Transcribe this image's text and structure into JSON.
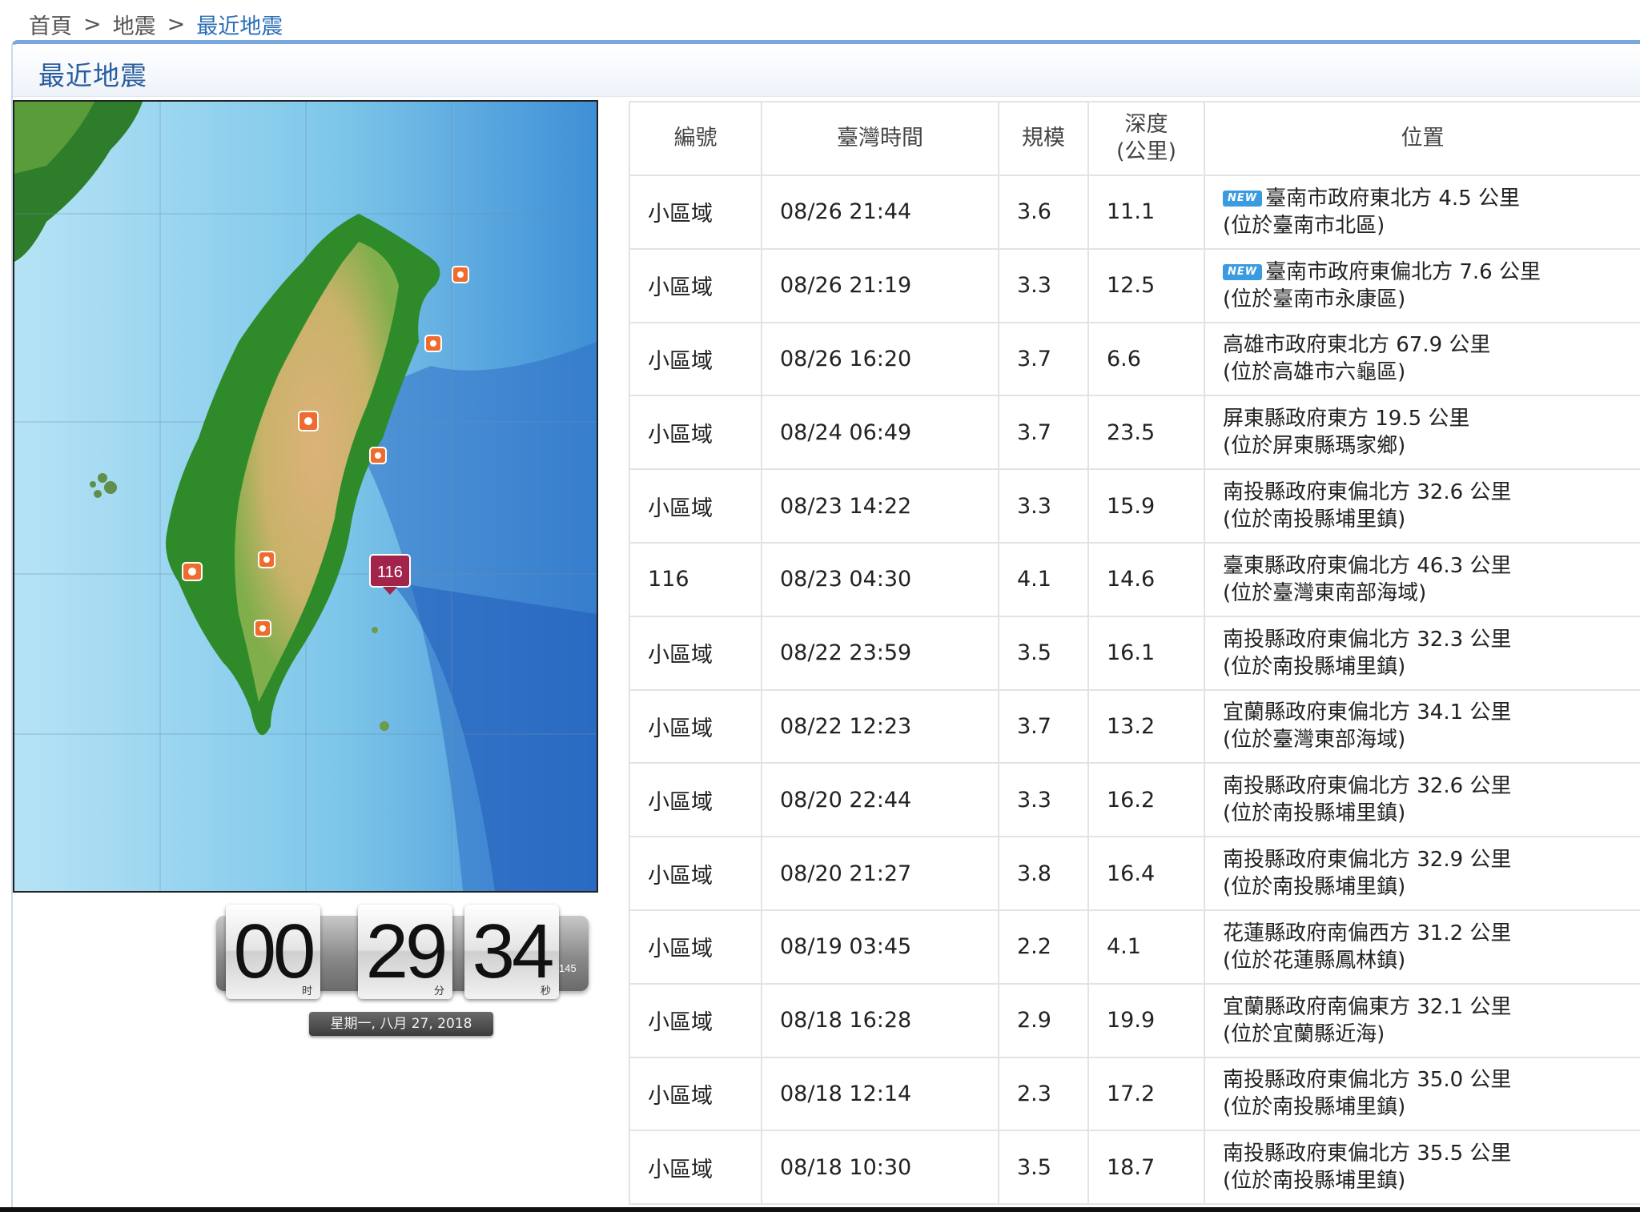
{
  "breadcrumb": {
    "home": "首頁",
    "separator": ">",
    "section": "地震",
    "current": "最近地震"
  },
  "panel": {
    "title": "最近地震"
  },
  "map": {
    "marker_label": "116"
  },
  "clock": {
    "hours": "00",
    "minutes": "29",
    "seconds": "34",
    "hours_unit": "时",
    "minutes_unit": "分",
    "seconds_unit": "秒",
    "milliseconds": "145",
    "date": "星期一, 八月 27, 2018"
  },
  "table": {
    "headers": {
      "id": "編號",
      "time": "臺灣時間",
      "magnitude": "規模",
      "depth_line1": "深度",
      "depth_line2": "(公里)",
      "location": "位置"
    },
    "new_tag": "NEW",
    "rows": [
      {
        "id": "小區域",
        "time": "08/26 21:44",
        "magnitude": "3.6",
        "depth": "11.1",
        "loc1": "臺南市政府東北方 4.5 公里",
        "loc2": "(位於臺南市北區)",
        "is_new": true
      },
      {
        "id": "小區域",
        "time": "08/26 21:19",
        "magnitude": "3.3",
        "depth": "12.5",
        "loc1": "臺南市政府東偏北方 7.6 公里",
        "loc2": "(位於臺南市永康區)",
        "is_new": true
      },
      {
        "id": "小區域",
        "time": "08/26 16:20",
        "magnitude": "3.7",
        "depth": "6.6",
        "loc1": "高雄市政府東北方 67.9 公里",
        "loc2": "(位於高雄市六龜區)",
        "is_new": false
      },
      {
        "id": "小區域",
        "time": "08/24 06:49",
        "magnitude": "3.7",
        "depth": "23.5",
        "loc1": "屏東縣政府東方 19.5 公里",
        "loc2": "(位於屏東縣瑪家鄉)",
        "is_new": false
      },
      {
        "id": "小區域",
        "time": "08/23 14:22",
        "magnitude": "3.3",
        "depth": "15.9",
        "loc1": "南投縣政府東偏北方 32.6 公里",
        "loc2": "(位於南投縣埔里鎮)",
        "is_new": false
      },
      {
        "id": "116",
        "time": "08/23 04:30",
        "magnitude": "4.1",
        "depth": "14.6",
        "loc1": "臺東縣政府東偏北方 46.3 公里",
        "loc2": "(位於臺灣東南部海域)",
        "is_new": false
      },
      {
        "id": "小區域",
        "time": "08/22 23:59",
        "magnitude": "3.5",
        "depth": "16.1",
        "loc1": "南投縣政府東偏北方 32.3 公里",
        "loc2": "(位於南投縣埔里鎮)",
        "is_new": false
      },
      {
        "id": "小區域",
        "time": "08/22 12:23",
        "magnitude": "3.7",
        "depth": "13.2",
        "loc1": "宜蘭縣政府東偏北方 34.1 公里",
        "loc2": "(位於臺灣東部海域)",
        "is_new": false
      },
      {
        "id": "小區域",
        "time": "08/20 22:44",
        "magnitude": "3.3",
        "depth": "16.2",
        "loc1": "南投縣政府東偏北方 32.6 公里",
        "loc2": "(位於南投縣埔里鎮)",
        "is_new": false
      },
      {
        "id": "小區域",
        "time": "08/20 21:27",
        "magnitude": "3.8",
        "depth": "16.4",
        "loc1": "南投縣政府東偏北方 32.9 公里",
        "loc2": "(位於南投縣埔里鎮)",
        "is_new": false
      },
      {
        "id": "小區域",
        "time": "08/19 03:45",
        "magnitude": "2.2",
        "depth": "4.1",
        "loc1": "花蓮縣政府南偏西方 31.2 公里",
        "loc2": "(位於花蓮縣鳳林鎮)",
        "is_new": false
      },
      {
        "id": "小區域",
        "time": "08/18 16:28",
        "magnitude": "2.9",
        "depth": "19.9",
        "loc1": "宜蘭縣政府南偏東方 32.1 公里",
        "loc2": "(位於宜蘭縣近海)",
        "is_new": false
      },
      {
        "id": "小區域",
        "time": "08/18 12:14",
        "magnitude": "2.3",
        "depth": "17.2",
        "loc1": "南投縣政府東偏北方 35.0 公里",
        "loc2": "(位於南投縣埔里鎮)",
        "is_new": false
      },
      {
        "id": "小區域",
        "time": "08/18 10:30",
        "magnitude": "3.5",
        "depth": "18.7",
        "loc1": "南投縣政府東偏北方 35.5 公里",
        "loc2": "(位於南投縣埔里鎮)",
        "is_new": false
      }
    ]
  },
  "colors": {
    "link": "#2a6fb6",
    "title": "#2a5d9f",
    "new_badge": "#3a9be0",
    "marker_small": "#ef6c2f",
    "marker_large": "#a3244a",
    "sea": "#a8dcf2",
    "land_low": "#2f8a2a",
    "land_high": "#d9b77c"
  }
}
